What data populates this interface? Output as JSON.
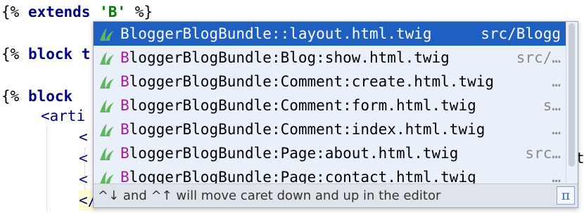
{
  "editor": {
    "lines": [
      {
        "open": "{% ",
        "keyword": "extends",
        "space": " ",
        "string": "'B'",
        "close": " %}"
      },
      {
        "open": "{% ",
        "keyword": "block",
        "rest": " t"
      },
      {
        "open": "{% ",
        "keyword": "block",
        "rest": " "
      },
      {
        "tag": "<arti"
      },
      {
        "tag": "<"
      },
      {
        "tag": "<"
      },
      {
        "tag": "<"
      },
      {
        "tag": "</"
      }
    ],
    "right_fragment": "t"
  },
  "completion": {
    "items": [
      {
        "prefix": "",
        "name": "BloggerBlogBundle::layout.html.twig",
        "path": "src/Blogg",
        "selected": true
      },
      {
        "prefix": "B",
        "name": "loggerBlogBundle:Blog:show.html.twig",
        "path": "src/…",
        "selected": false
      },
      {
        "prefix": "B",
        "name": "loggerBlogBundle:Comment:create.html.twig",
        "path": "…",
        "selected": false
      },
      {
        "prefix": "B",
        "name": "loggerBlogBundle:Comment:form.html.twig",
        "path": "s…",
        "selected": false
      },
      {
        "prefix": "B",
        "name": "loggerBlogBundle:Comment:index.html.twig",
        "path": "…",
        "selected": false
      },
      {
        "prefix": "B",
        "name": "loggerBlogBundle:Page:about.html.twig",
        "path": "src…",
        "selected": false
      },
      {
        "prefix": "B",
        "name": "loggerBlogBundle:Page:contact.html.twig",
        "path": "…",
        "selected": false
      }
    ],
    "icon": "twig-leaf-icon",
    "hint": "^↓ and ^↑ will move caret down and up in the editor",
    "pi_label": "π"
  },
  "colors": {
    "selection": "#1e5fc2",
    "popup_bg": "#eaf0fa",
    "keyword": "#000080",
    "string": "#008000",
    "match_letter": "#a61a9c",
    "icon_green": "#5cb85c"
  }
}
